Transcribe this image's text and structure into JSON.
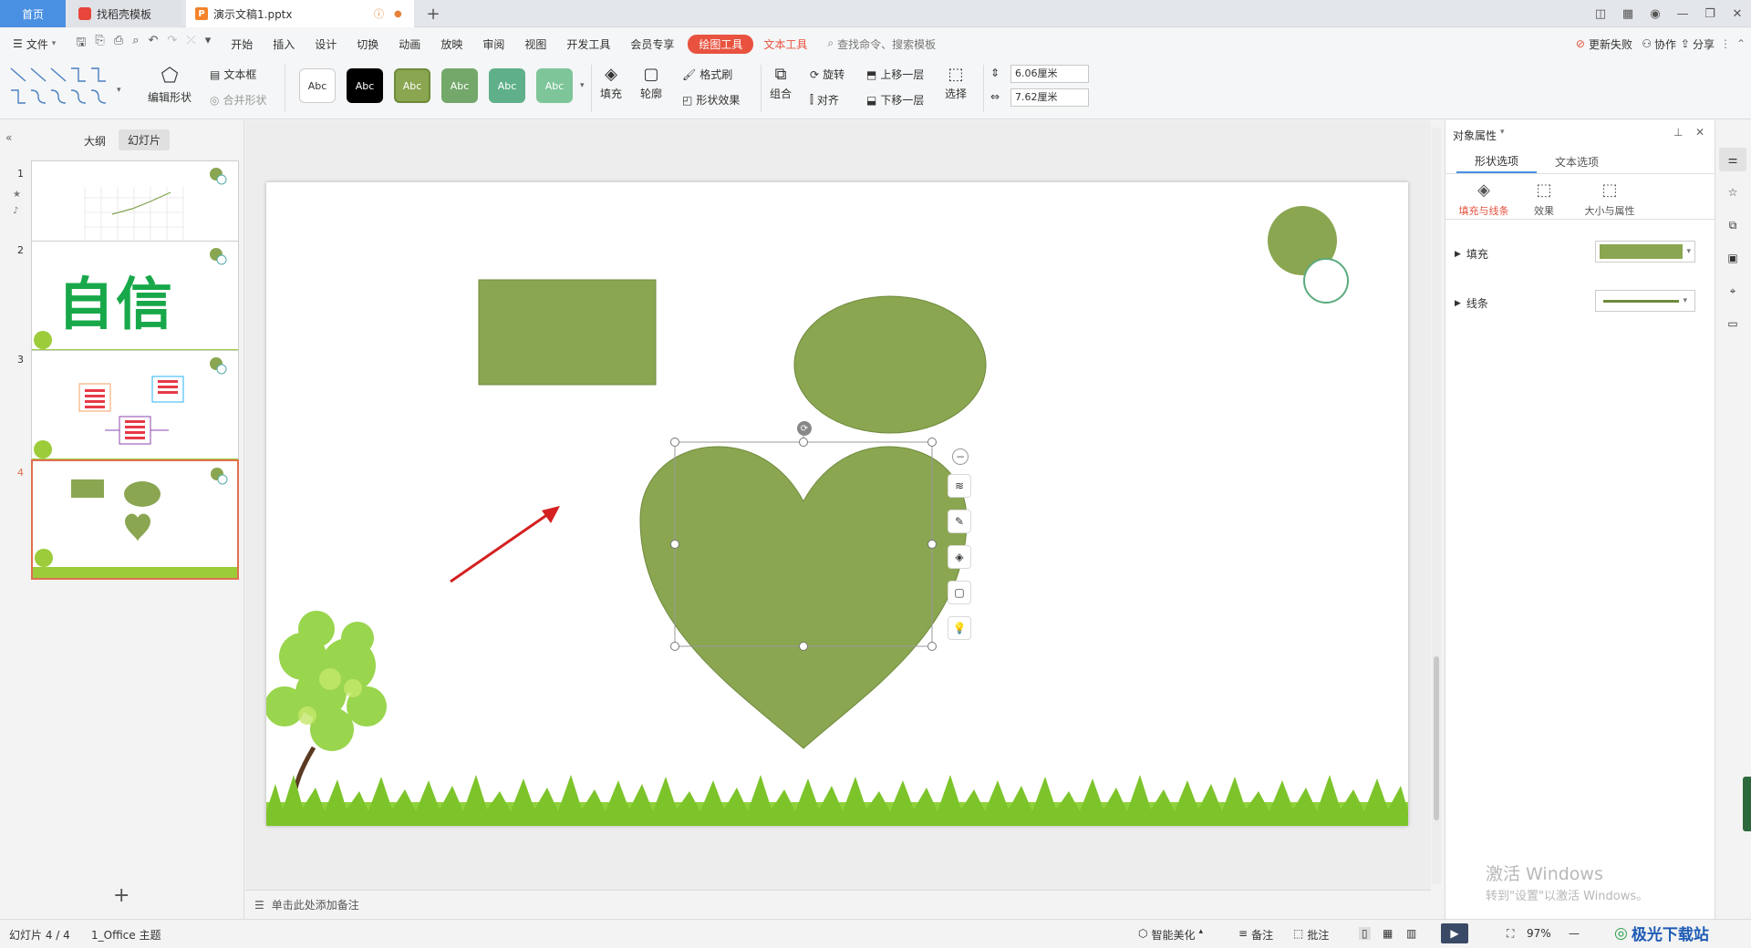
{
  "titlebar": {
    "tabs": [
      {
        "label": "首页"
      },
      {
        "label": "找稻壳模板"
      },
      {
        "label": "演示文稿1.pptx"
      }
    ],
    "new_tab": "+"
  },
  "menu": {
    "file": "文件",
    "items": [
      "开始",
      "插入",
      "设计",
      "切换",
      "动画",
      "放映",
      "审阅",
      "视图",
      "开发工具",
      "会员专享"
    ],
    "drawing_tools": "绘图工具",
    "text_tools": "文本工具",
    "search_placeholder": "查找命令、搜索模板",
    "update_failed": "更新失败",
    "collaborate": "协作",
    "share": "分享"
  },
  "toolbar": {
    "edit_shape": "编辑形状",
    "text_box": "文本框",
    "merge_shape": "合并形状",
    "style_label": "Abc",
    "fill": "填充",
    "outline": "轮廓",
    "format_painter": "格式刷",
    "shape_effect": "形状效果",
    "combine": "组合",
    "rotate": "旋转",
    "align": "对齐",
    "bring_forward": "上移一层",
    "send_backward": "下移一层",
    "select": "选择",
    "height_value": "6.06厘米",
    "width_value": "7.62厘米"
  },
  "left_panel": {
    "tab_outline": "大纲",
    "tab_slides": "幻灯片",
    "slide_numbers": [
      "1",
      "2",
      "3",
      "4"
    ],
    "slide2_text": "自信"
  },
  "notes": {
    "placeholder": "单击此处添加备注"
  },
  "right_panel": {
    "title": "对象属性",
    "tab_shape": "形状选项",
    "tab_text": "文本选项",
    "sub_fill_line": "填充与线条",
    "sub_effect": "效果",
    "sub_size": "大小与属性",
    "fill_label": "填充",
    "line_label": "线条"
  },
  "watermark": {
    "line1": "激活 Windows",
    "line2": "转到\"设置\"以激活 Windows。"
  },
  "statusbar": {
    "slide_info": "幻灯片 4 / 4",
    "theme": "1_Office 主题",
    "smart_beautify": "智能美化",
    "notes": "备注",
    "comments": "批注",
    "zoom": "97%",
    "brand": "极光下载站"
  },
  "colors": {
    "shape_green": "#8aa651",
    "accent_red": "#e8523f",
    "selection_orange": "#e07050"
  }
}
